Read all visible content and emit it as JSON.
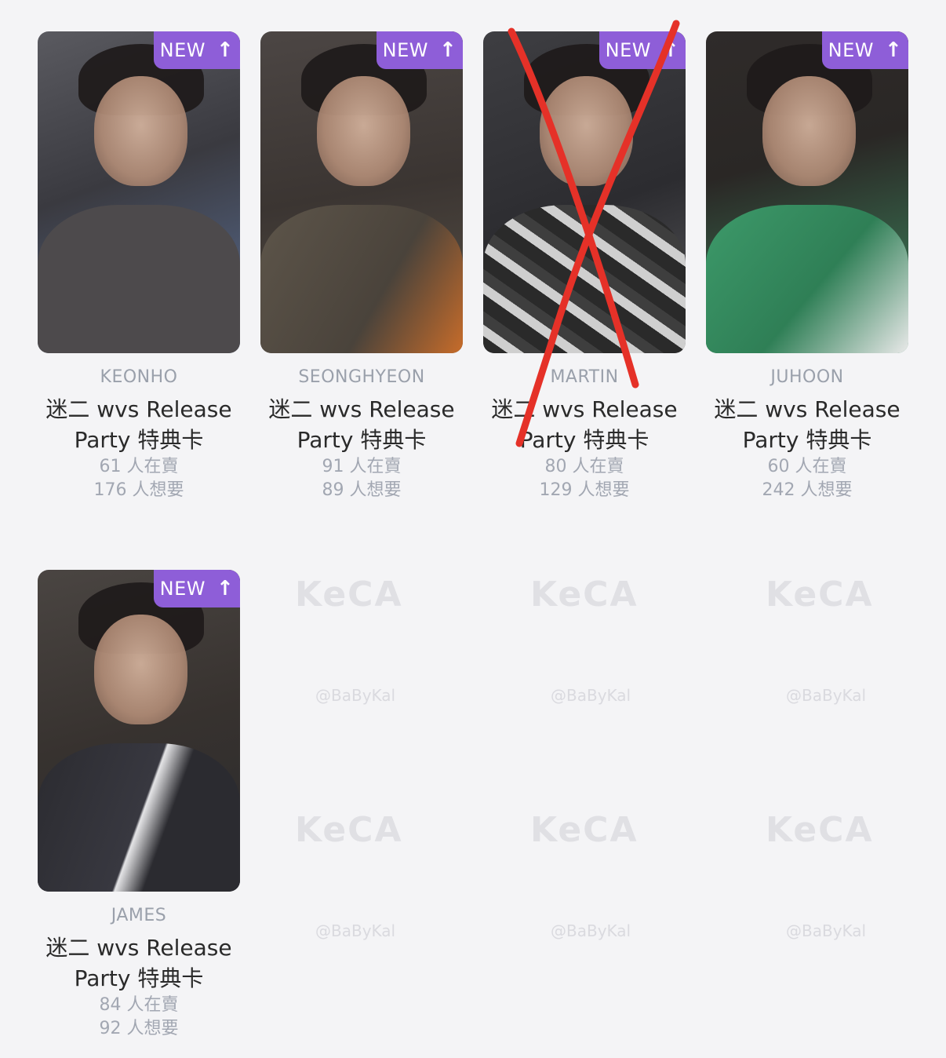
{
  "badge": {
    "new_label": "NEW",
    "arrow_icon": "arrow-up-icon"
  },
  "watermark": {
    "logo": "KeCA",
    "handle": "@BaByKal"
  },
  "colors": {
    "accent": "#8e5ed8",
    "cross_mark": "#e53128"
  },
  "cards": [
    {
      "member": "KEONHO",
      "title": "迷二 wvs Release Party 特典卡",
      "selling": "61 人在賣",
      "wanting": "176 人想要",
      "crossed_out": false
    },
    {
      "member": "SEONGHYEON",
      "title": "迷二 wvs Release Party 特典卡",
      "selling": "91 人在賣",
      "wanting": "89 人想要",
      "crossed_out": false
    },
    {
      "member": "MARTIN",
      "title": "迷二 wvs Release Party 特典卡",
      "selling": "80 人在賣",
      "wanting": "129 人想要",
      "crossed_out": true
    },
    {
      "member": "JUHOON",
      "title": "迷二 wvs Release Party 特典卡",
      "selling": "60 人在賣",
      "wanting": "242 人想要",
      "crossed_out": false
    },
    {
      "member": "JAMES",
      "title": "迷二 wvs Release Party 特典卡",
      "selling": "84 人在賣",
      "wanting": "92 人想要",
      "crossed_out": false
    }
  ]
}
